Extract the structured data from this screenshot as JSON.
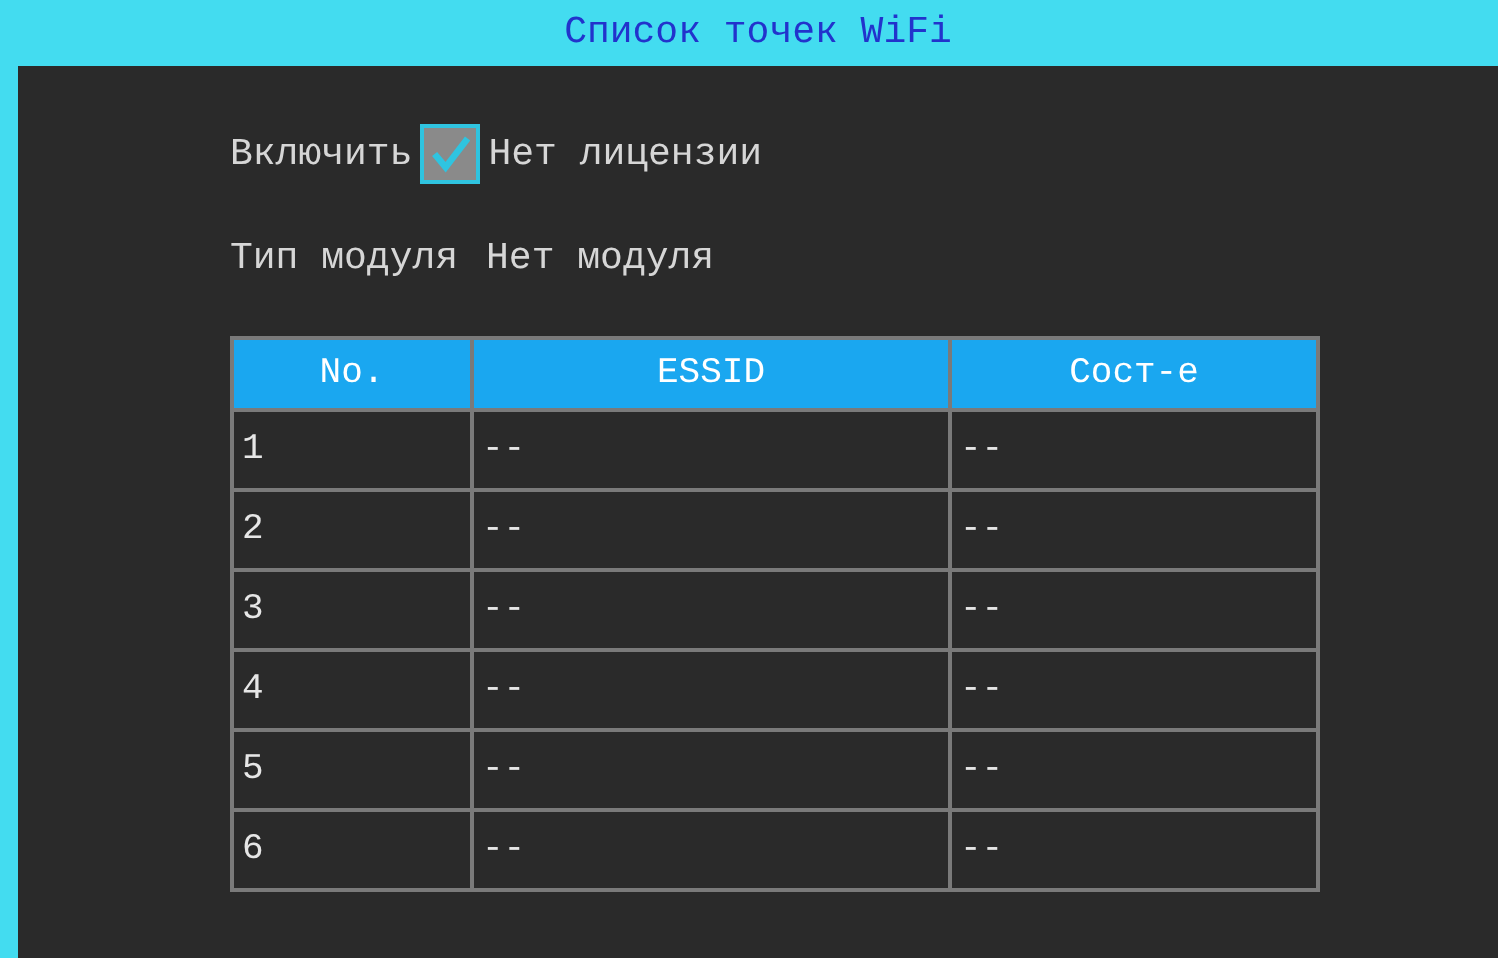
{
  "window": {
    "title": "Список точек WiFi"
  },
  "enable": {
    "label": "Включить",
    "checked": true,
    "status": "Нет лицензии"
  },
  "module": {
    "label": "Тип модуля",
    "value": "Нет модуля"
  },
  "table": {
    "columns": [
      "No.",
      "ESSID",
      "Сост-е"
    ],
    "rows": [
      [
        "1",
        "--",
        "--"
      ],
      [
        "2",
        "--",
        "--"
      ],
      [
        "3",
        "--",
        "--"
      ],
      [
        "4",
        "--",
        "--"
      ],
      [
        "5",
        "--",
        "--"
      ],
      [
        "6",
        "--",
        "--"
      ]
    ]
  }
}
